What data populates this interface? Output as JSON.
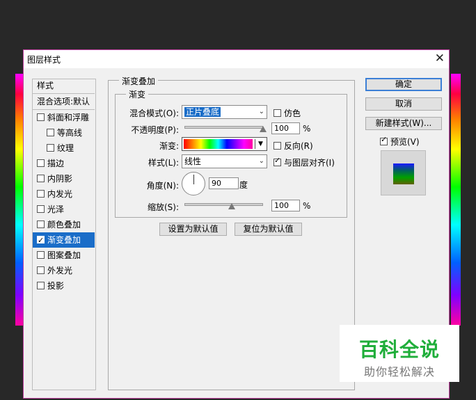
{
  "dialog": {
    "title": "图层样式",
    "close_icon": "✕"
  },
  "sidebar": {
    "header": "样式",
    "blend_options": "混合选项:默认",
    "items": [
      {
        "label": "斜面和浮雕",
        "checked": false
      },
      {
        "label": "等高线",
        "checked": false
      },
      {
        "label": "纹理",
        "checked": false
      },
      {
        "label": "描边",
        "checked": false
      },
      {
        "label": "内阴影",
        "checked": false
      },
      {
        "label": "内发光",
        "checked": false
      },
      {
        "label": "光泽",
        "checked": false
      },
      {
        "label": "颜色叠加",
        "checked": false
      },
      {
        "label": "渐变叠加",
        "checked": true,
        "selected": true
      },
      {
        "label": "图案叠加",
        "checked": false
      },
      {
        "label": "外发光",
        "checked": false
      },
      {
        "label": "投影",
        "checked": false
      }
    ]
  },
  "gradient_overlay": {
    "title": "渐变叠加",
    "group_title": "渐变",
    "blend_mode_label": "混合模式(O):",
    "blend_mode_value": "正片叠底",
    "dither_label": "仿色",
    "opacity_label": "不透明度(P):",
    "opacity_value": "100",
    "percent": "%",
    "gradient_label": "渐变:",
    "reverse_label": "反向(R)",
    "style_label": "样式(L):",
    "style_value": "线性",
    "align_label": "与图层对齐(I)",
    "align_checked": true,
    "angle_label": "角度(N):",
    "angle_value": "90",
    "angle_unit": "度",
    "scale_label": "缩放(S):",
    "scale_value": "100",
    "opacity_fraction": 1.0,
    "scale_fraction": 0.6,
    "make_default": "设置为默认值",
    "reset_default": "复位为默认值"
  },
  "buttons": {
    "ok": "确定",
    "cancel": "取消",
    "new_style": "新建样式(W)...",
    "preview": "预览(V)",
    "preview_checked": true
  },
  "watermark": {
    "line1": "百科全说",
    "line2": "助你轻松解决"
  },
  "colors": {
    "accent": "#1a6dc8",
    "border": "#c040a0",
    "watermark_green": "#1fae3a"
  }
}
